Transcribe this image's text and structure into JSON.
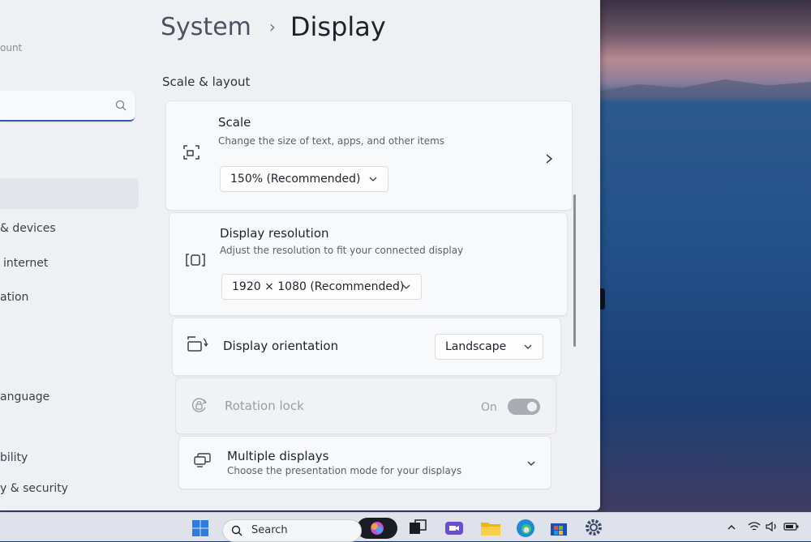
{
  "sidebar": {
    "account_fragment": "ount",
    "search": {
      "placeholder": ""
    },
    "items": [
      {
        "label": "& devices"
      },
      {
        "label": "internet"
      },
      {
        "label": "ation"
      },
      {
        "label": "anguage"
      },
      {
        "label": "bility"
      },
      {
        "label": "y & security"
      }
    ]
  },
  "breadcrumb": {
    "parent": "System",
    "separator": "›",
    "current": "Display"
  },
  "section_title": "Scale & layout",
  "settings": {
    "scale": {
      "title": "Scale",
      "description": "Change the size of text, apps, and other items",
      "value": "150% (Recommended)"
    },
    "resolution": {
      "title": "Display resolution",
      "description": "Adjust the resolution to fit your connected display",
      "value": "1920 × 1080 (Recommended)"
    },
    "orientation": {
      "title": "Display orientation",
      "value": "Landscape"
    },
    "rotation_lock": {
      "title": "Rotation lock",
      "state_label": "On",
      "enabled": false
    },
    "multiple_displays": {
      "title": "Multiple displays",
      "description": "Choose the presentation mode for your displays"
    }
  },
  "taskbar": {
    "search_label": "Search"
  },
  "colors": {
    "accent": "#2d5bb8",
    "window_bg": "#eef0f4",
    "card_bg": "#f8f9fa"
  }
}
